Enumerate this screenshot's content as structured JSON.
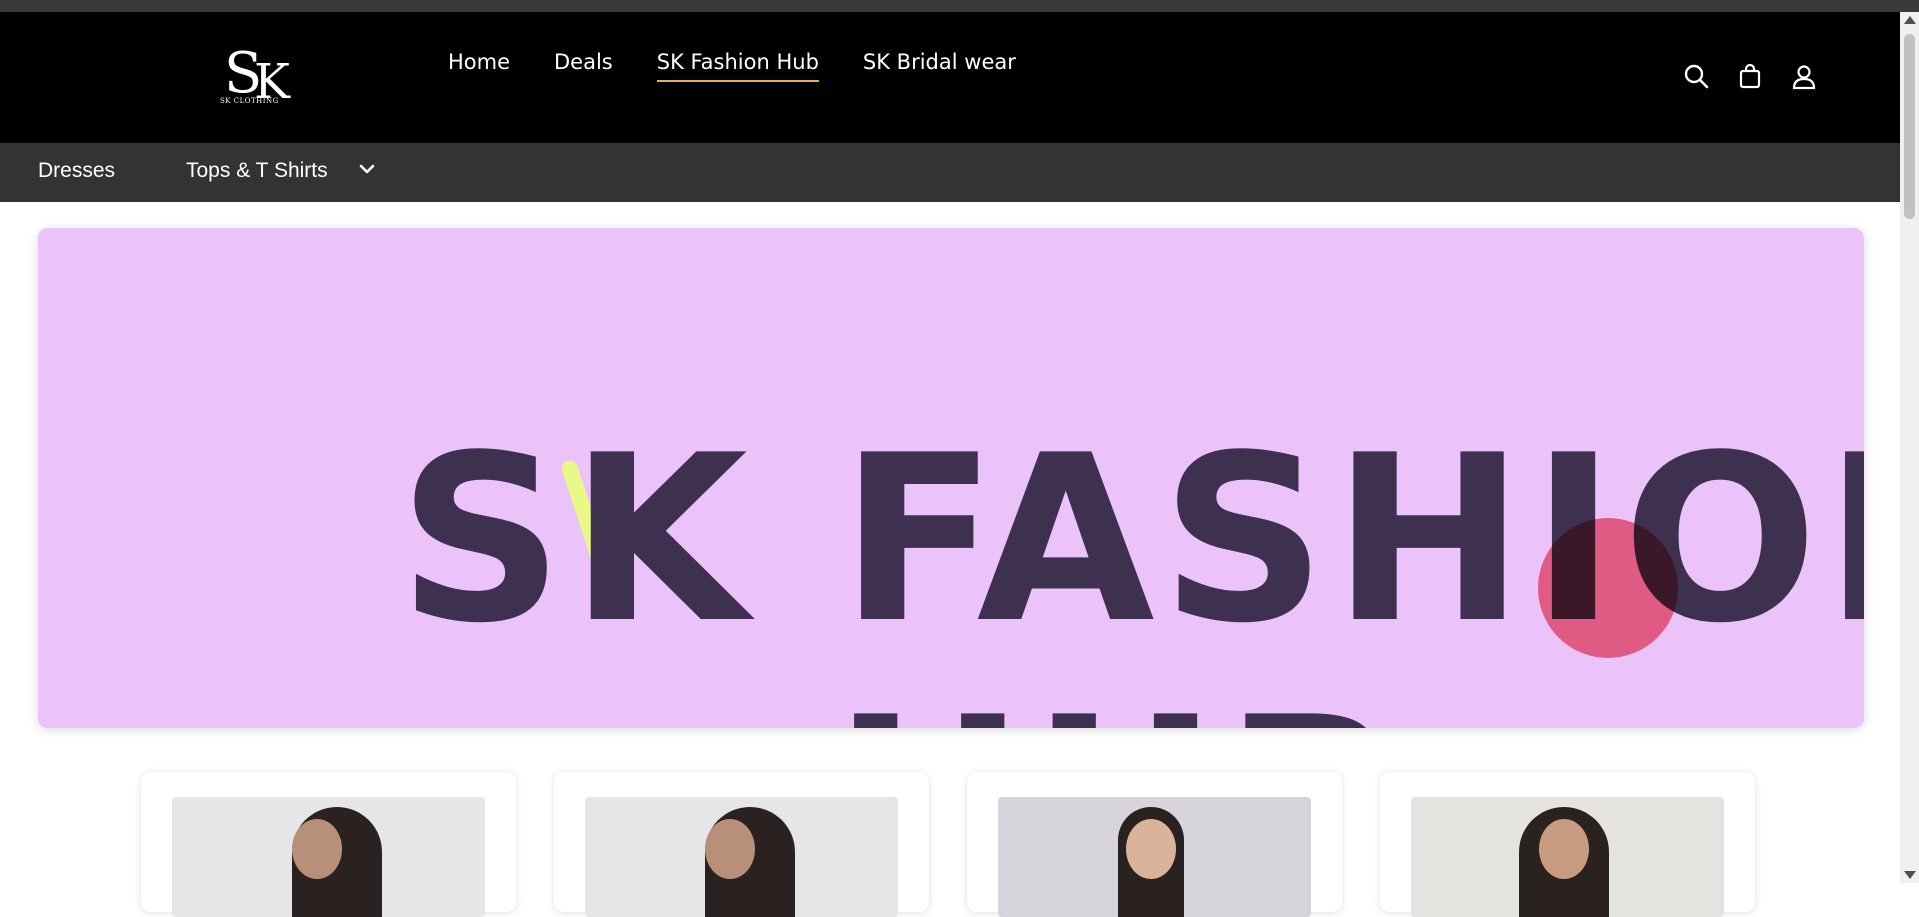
{
  "logo": {
    "letters": "SK",
    "subtext": "SK CLOTHING"
  },
  "nav": {
    "items": [
      {
        "label": "Home",
        "active": false
      },
      {
        "label": "Deals",
        "active": false
      },
      {
        "label": "SK Fashion Hub",
        "active": true
      },
      {
        "label": "SK Bridal wear",
        "active": false
      }
    ],
    "icons": [
      "search-icon",
      "shopping-bag-icon",
      "account-icon"
    ]
  },
  "subnav": {
    "items": [
      "Dresses",
      "Tops & T Shirts"
    ],
    "dropdown_icon": "chevron-down-icon"
  },
  "banner": {
    "title": "SK FASHION",
    "subtitle": "HUB",
    "background": "#ecc2fb",
    "text_color": "#3e3150"
  },
  "products": {
    "count": 4,
    "image_backgrounds": [
      "#e6e6e8",
      "#e6e6e8",
      "#d8d4dc",
      "#e4e3df"
    ]
  },
  "colors": {
    "header_bg": "#000000",
    "subnav_bg": "#333333",
    "active_underline": "#e3b04b"
  }
}
